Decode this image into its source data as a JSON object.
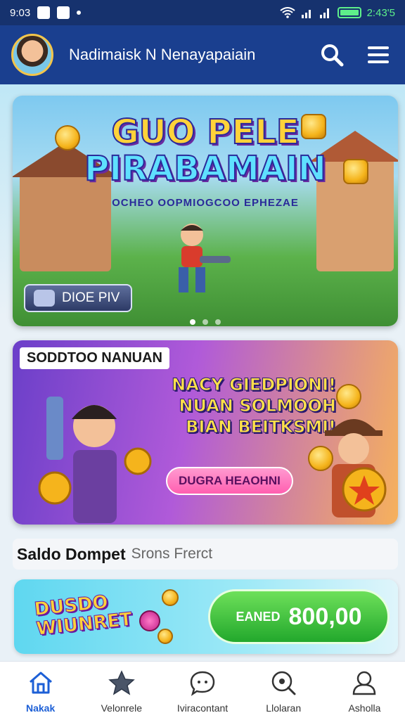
{
  "status_bar": {
    "time": "9:03",
    "right_text": "2:43'5"
  },
  "app_bar": {
    "title": "Nadimaisk N Nenayapaiain"
  },
  "hero": {
    "title_line1": "GUO PELE",
    "title_line2": "PIRABAMAIN",
    "subtitle": "OCHEO OOPMIOGCOO EPHEZAE",
    "button_label": "DIOE PIV",
    "pager": {
      "count": 3,
      "active_index": 0
    }
  },
  "promo": {
    "tag": "SODDTOO NANUAN",
    "headline": [
      "NACY GIEDPIONI!",
      "NUAN SOLMOOH",
      "BIAN BEITKSMI!"
    ],
    "pill_label": "DUGRA HEAOHNI"
  },
  "wallet": {
    "section_title": "Saldo Dompet",
    "section_subtitle": "Srons Frerct",
    "logo_line1": "DUSDO",
    "logo_line2": "WIUNRET",
    "button_label": "EANED",
    "amount": "800,00"
  },
  "nav": {
    "items": [
      {
        "label": "Nakak",
        "icon": "home-icon",
        "active": true
      },
      {
        "label": "Velonrele",
        "icon": "star-icon",
        "active": false
      },
      {
        "label": "Iviracontant",
        "icon": "chat-icon",
        "active": false
      },
      {
        "label": "Llolaran",
        "icon": "search-icon",
        "active": false
      },
      {
        "label": "Asholla",
        "icon": "profile-icon",
        "active": false
      }
    ]
  },
  "colors": {
    "header": "#1a3f8f",
    "accent": "#1c5fd6",
    "wallet_button": "#22a82c"
  }
}
